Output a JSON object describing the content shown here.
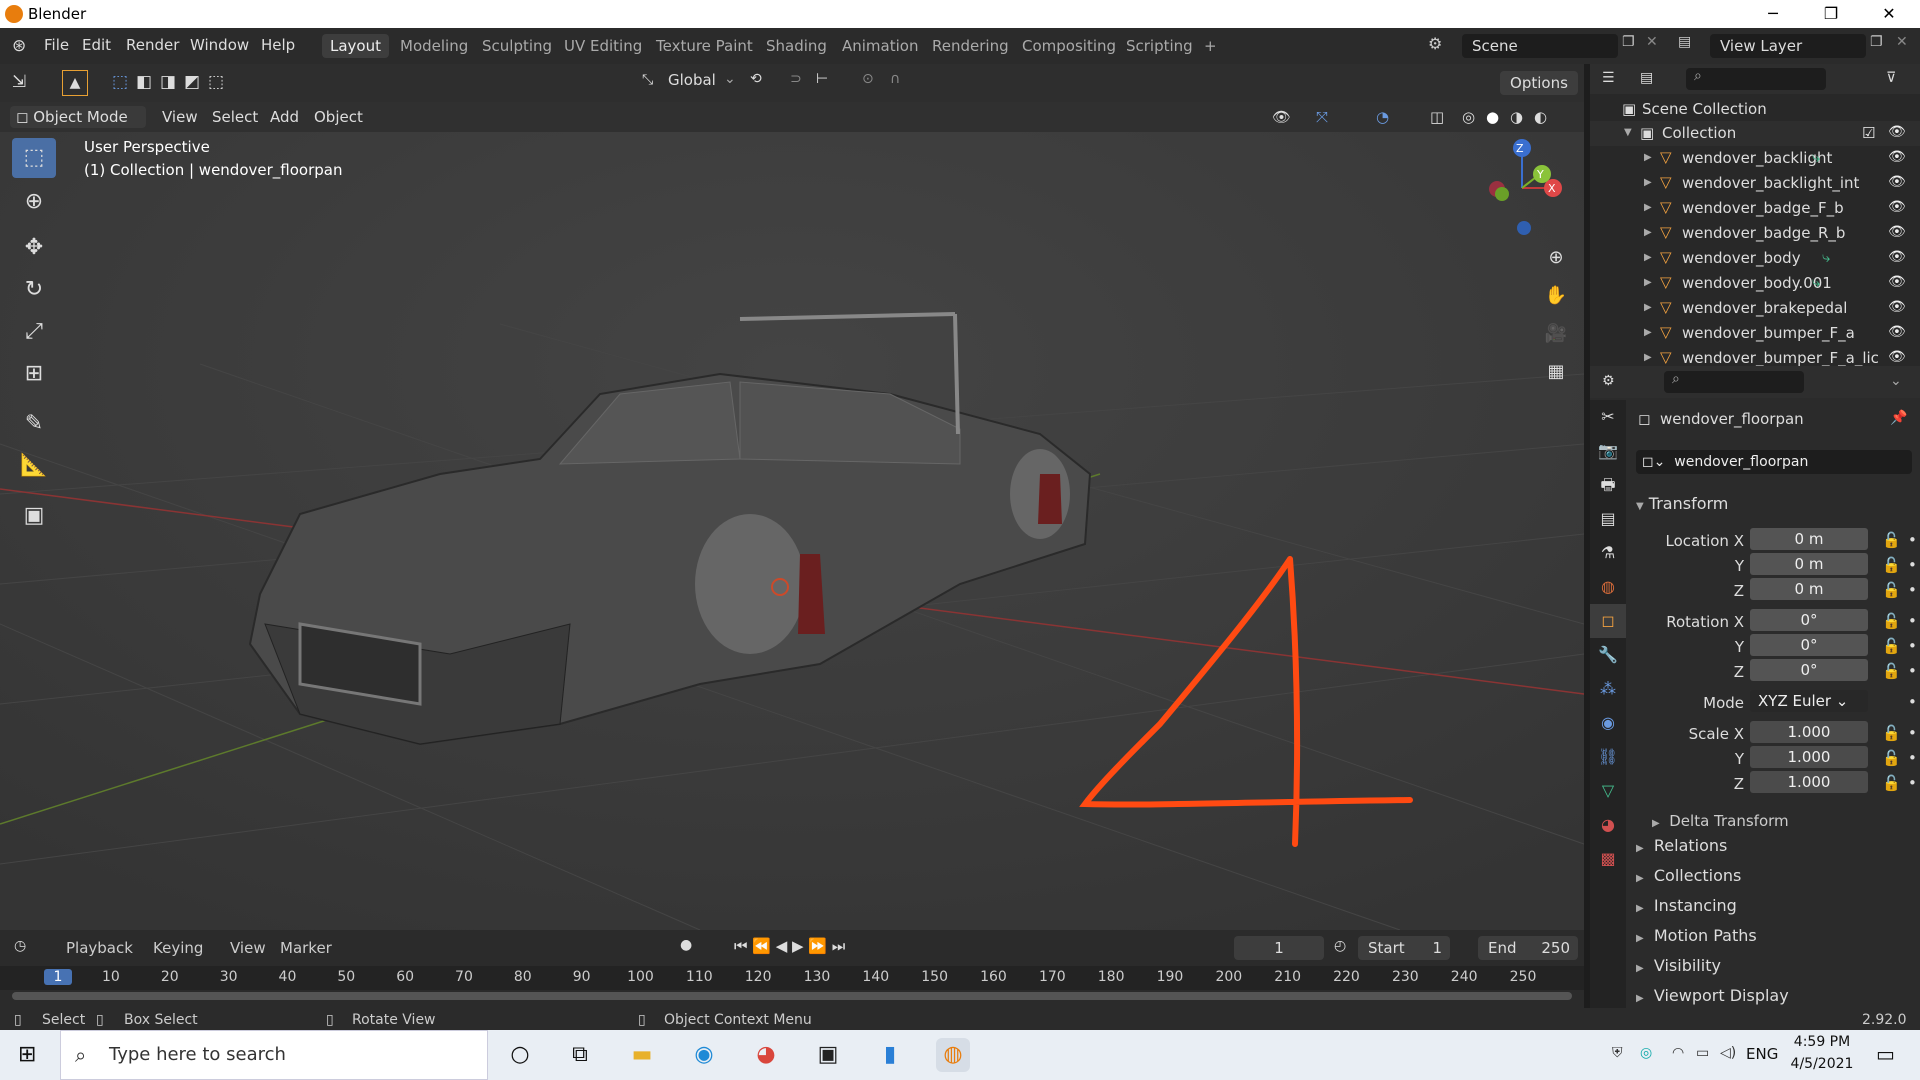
{
  "window": {
    "app_title": "Blender",
    "min": "─",
    "max": "❐",
    "close": "✕"
  },
  "topbar": {
    "menus": [
      "File",
      "Edit",
      "Render",
      "Window",
      "Help"
    ],
    "workspaces": [
      "Layout",
      "Modeling",
      "Sculpting",
      "UV Editing",
      "Texture Paint",
      "Shading",
      "Animation",
      "Rendering",
      "Compositing",
      "Scripting"
    ],
    "add_ws": "+",
    "scene": "Scene",
    "view_layer": "View Layer"
  },
  "viewport": {
    "orientation": "Global",
    "options": "Options",
    "mode": "Object Mode",
    "menus": [
      "View",
      "Select",
      "Add",
      "Object"
    ],
    "overlay_line1": "User Perspective",
    "overlay_line2": "(1) Collection | wendover_floorpan",
    "gizmo": {
      "z": "Z",
      "y": "Y",
      "x": "X"
    },
    "annotation": "4",
    "annotation_color": "#ff4a12"
  },
  "timeline": {
    "menus": [
      "Playback",
      "Keying",
      "View",
      "Marker"
    ],
    "current_frame": "1",
    "start_label": "Start",
    "start": "1",
    "end_label": "End",
    "end": "250",
    "ticks": [
      "1",
      "10",
      "20",
      "30",
      "40",
      "50",
      "60",
      "70",
      "80",
      "90",
      "100",
      "110",
      "120",
      "130",
      "140",
      "150",
      "160",
      "170",
      "180",
      "190",
      "200",
      "210",
      "220",
      "230",
      "240",
      "250"
    ]
  },
  "status": {
    "select": "Select",
    "box_select": "Box Select",
    "rotate": "Rotate View",
    "context": "Object Context Menu",
    "version": "2.92.0"
  },
  "outliner": {
    "scene_collection": "Scene Collection",
    "collection": "Collection",
    "items": [
      "wendover_backlight",
      "wendover_backlight_int",
      "wendover_badge_F_b",
      "wendover_badge_R_b",
      "wendover_body",
      "wendover_body.001",
      "wendover_brakepedal",
      "wendover_bumper_F_a",
      "wendover_bumper_F_a_lic"
    ]
  },
  "properties": {
    "object_name": "wendover_floorpan",
    "datablock": "wendover_floorpan",
    "transform": "Transform",
    "location": {
      "label": "Location X",
      "x": "0 m",
      "y": "0 m",
      "z": "0 m"
    },
    "rotation": {
      "label": "Rotation X",
      "x": "0°",
      "y": "0°",
      "z": "0°"
    },
    "mode_label": "Mode",
    "mode": "XYZ Euler",
    "scale": {
      "label": "Scale X",
      "x": "1.000",
      "y": "1.000",
      "z": "1.000"
    },
    "axis_y": "Y",
    "axis_z": "Z",
    "delta": "Delta Transform",
    "panels": [
      "Relations",
      "Collections",
      "Instancing",
      "Motion Paths",
      "Visibility",
      "Viewport Display"
    ]
  },
  "taskbar": {
    "search_placeholder": "Type here to search",
    "time": "4:59 PM",
    "date": "4/5/2021",
    "lang": "ENG"
  }
}
